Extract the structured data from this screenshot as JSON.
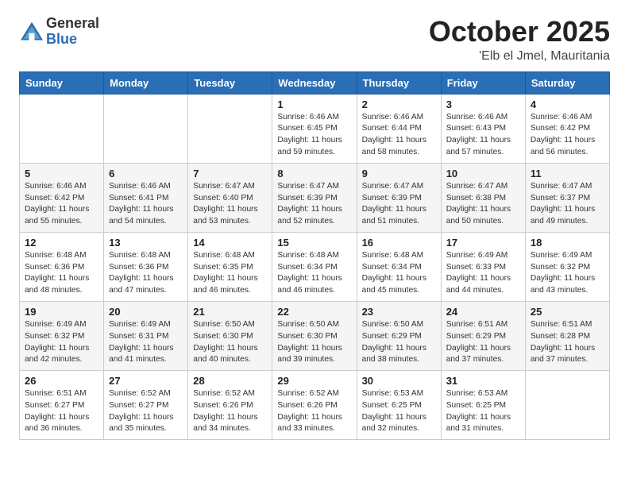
{
  "logo": {
    "general": "General",
    "blue": "Blue"
  },
  "header": {
    "month": "October 2025",
    "location": "'Elb el Jmel, Mauritania"
  },
  "days_of_week": [
    "Sunday",
    "Monday",
    "Tuesday",
    "Wednesday",
    "Thursday",
    "Friday",
    "Saturday"
  ],
  "weeks": [
    [
      {
        "day": "",
        "info": ""
      },
      {
        "day": "",
        "info": ""
      },
      {
        "day": "",
        "info": ""
      },
      {
        "day": "1",
        "info": "Sunrise: 6:46 AM\nSunset: 6:45 PM\nDaylight: 11 hours\nand 59 minutes."
      },
      {
        "day": "2",
        "info": "Sunrise: 6:46 AM\nSunset: 6:44 PM\nDaylight: 11 hours\nand 58 minutes."
      },
      {
        "day": "3",
        "info": "Sunrise: 6:46 AM\nSunset: 6:43 PM\nDaylight: 11 hours\nand 57 minutes."
      },
      {
        "day": "4",
        "info": "Sunrise: 6:46 AM\nSunset: 6:42 PM\nDaylight: 11 hours\nand 56 minutes."
      }
    ],
    [
      {
        "day": "5",
        "info": "Sunrise: 6:46 AM\nSunset: 6:42 PM\nDaylight: 11 hours\nand 55 minutes."
      },
      {
        "day": "6",
        "info": "Sunrise: 6:46 AM\nSunset: 6:41 PM\nDaylight: 11 hours\nand 54 minutes."
      },
      {
        "day": "7",
        "info": "Sunrise: 6:47 AM\nSunset: 6:40 PM\nDaylight: 11 hours\nand 53 minutes."
      },
      {
        "day": "8",
        "info": "Sunrise: 6:47 AM\nSunset: 6:39 PM\nDaylight: 11 hours\nand 52 minutes."
      },
      {
        "day": "9",
        "info": "Sunrise: 6:47 AM\nSunset: 6:39 PM\nDaylight: 11 hours\nand 51 minutes."
      },
      {
        "day": "10",
        "info": "Sunrise: 6:47 AM\nSunset: 6:38 PM\nDaylight: 11 hours\nand 50 minutes."
      },
      {
        "day": "11",
        "info": "Sunrise: 6:47 AM\nSunset: 6:37 PM\nDaylight: 11 hours\nand 49 minutes."
      }
    ],
    [
      {
        "day": "12",
        "info": "Sunrise: 6:48 AM\nSunset: 6:36 PM\nDaylight: 11 hours\nand 48 minutes."
      },
      {
        "day": "13",
        "info": "Sunrise: 6:48 AM\nSunset: 6:36 PM\nDaylight: 11 hours\nand 47 minutes."
      },
      {
        "day": "14",
        "info": "Sunrise: 6:48 AM\nSunset: 6:35 PM\nDaylight: 11 hours\nand 46 minutes."
      },
      {
        "day": "15",
        "info": "Sunrise: 6:48 AM\nSunset: 6:34 PM\nDaylight: 11 hours\nand 46 minutes."
      },
      {
        "day": "16",
        "info": "Sunrise: 6:48 AM\nSunset: 6:34 PM\nDaylight: 11 hours\nand 45 minutes."
      },
      {
        "day": "17",
        "info": "Sunrise: 6:49 AM\nSunset: 6:33 PM\nDaylight: 11 hours\nand 44 minutes."
      },
      {
        "day": "18",
        "info": "Sunrise: 6:49 AM\nSunset: 6:32 PM\nDaylight: 11 hours\nand 43 minutes."
      }
    ],
    [
      {
        "day": "19",
        "info": "Sunrise: 6:49 AM\nSunset: 6:32 PM\nDaylight: 11 hours\nand 42 minutes."
      },
      {
        "day": "20",
        "info": "Sunrise: 6:49 AM\nSunset: 6:31 PM\nDaylight: 11 hours\nand 41 minutes."
      },
      {
        "day": "21",
        "info": "Sunrise: 6:50 AM\nSunset: 6:30 PM\nDaylight: 11 hours\nand 40 minutes."
      },
      {
        "day": "22",
        "info": "Sunrise: 6:50 AM\nSunset: 6:30 PM\nDaylight: 11 hours\nand 39 minutes."
      },
      {
        "day": "23",
        "info": "Sunrise: 6:50 AM\nSunset: 6:29 PM\nDaylight: 11 hours\nand 38 minutes."
      },
      {
        "day": "24",
        "info": "Sunrise: 6:51 AM\nSunset: 6:29 PM\nDaylight: 11 hours\nand 37 minutes."
      },
      {
        "day": "25",
        "info": "Sunrise: 6:51 AM\nSunset: 6:28 PM\nDaylight: 11 hours\nand 37 minutes."
      }
    ],
    [
      {
        "day": "26",
        "info": "Sunrise: 6:51 AM\nSunset: 6:27 PM\nDaylight: 11 hours\nand 36 minutes."
      },
      {
        "day": "27",
        "info": "Sunrise: 6:52 AM\nSunset: 6:27 PM\nDaylight: 11 hours\nand 35 minutes."
      },
      {
        "day": "28",
        "info": "Sunrise: 6:52 AM\nSunset: 6:26 PM\nDaylight: 11 hours\nand 34 minutes."
      },
      {
        "day": "29",
        "info": "Sunrise: 6:52 AM\nSunset: 6:26 PM\nDaylight: 11 hours\nand 33 minutes."
      },
      {
        "day": "30",
        "info": "Sunrise: 6:53 AM\nSunset: 6:25 PM\nDaylight: 11 hours\nand 32 minutes."
      },
      {
        "day": "31",
        "info": "Sunrise: 6:53 AM\nSunset: 6:25 PM\nDaylight: 11 hours\nand 31 minutes."
      },
      {
        "day": "",
        "info": ""
      }
    ]
  ]
}
